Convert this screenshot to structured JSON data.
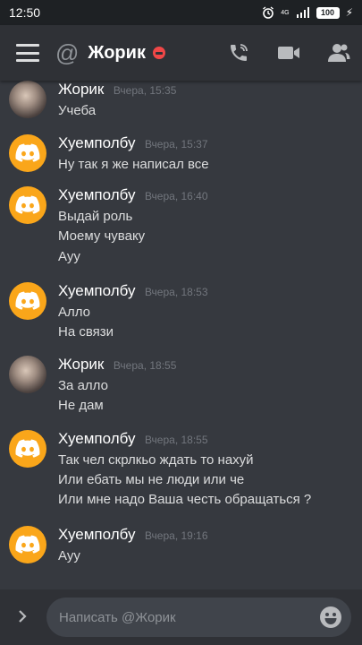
{
  "status_bar": {
    "time": "12:50",
    "network": "4G",
    "battery": "100"
  },
  "header": {
    "channel_prefix": "@",
    "channel_name": "Жорик",
    "status": "dnd"
  },
  "colors": {
    "accent": "#faa61a",
    "background": "#36393f",
    "header": "#2f3136",
    "dnd": "#f04747"
  },
  "messages": [
    {
      "author": "Жорик",
      "time": "Вчера, 15:35",
      "avatar": "photo",
      "lines": [
        "Учеба"
      ]
    },
    {
      "author": "Хуемполбу",
      "time": "Вчера, 15:37",
      "avatar": "discord-logo-icon",
      "lines": [
        "Ну так я же написал все"
      ]
    },
    {
      "author": "Хуемполбу",
      "time": "Вчера, 16:40",
      "avatar": "discord-logo-icon",
      "lines": [
        "Выдай роль",
        "Моему чуваку",
        "Ауу"
      ]
    },
    {
      "author": "Хуемполбу",
      "time": "Вчера, 18:53",
      "avatar": "discord-logo-icon",
      "lines": [
        "Алло",
        "На связи"
      ]
    },
    {
      "author": "Жорик",
      "time": "Вчера, 18:55",
      "avatar": "photo",
      "lines": [
        "За алло",
        "Не дам"
      ]
    },
    {
      "author": "Хуемполбу",
      "time": "Вчера, 18:55",
      "avatar": "discord-logo-icon",
      "lines": [
        "Так чел скрлкьо ждать то нахуй",
        "Или ебать мы не люди или че",
        "Или мне надо Ваша честь обращаться ?"
      ]
    },
    {
      "author": "Хуемполбу",
      "time": "Вчера, 19:16",
      "avatar": "discord-logo-icon",
      "lines": [
        "Ауу"
      ]
    }
  ],
  "composer": {
    "placeholder": "Написать @Жорик"
  }
}
